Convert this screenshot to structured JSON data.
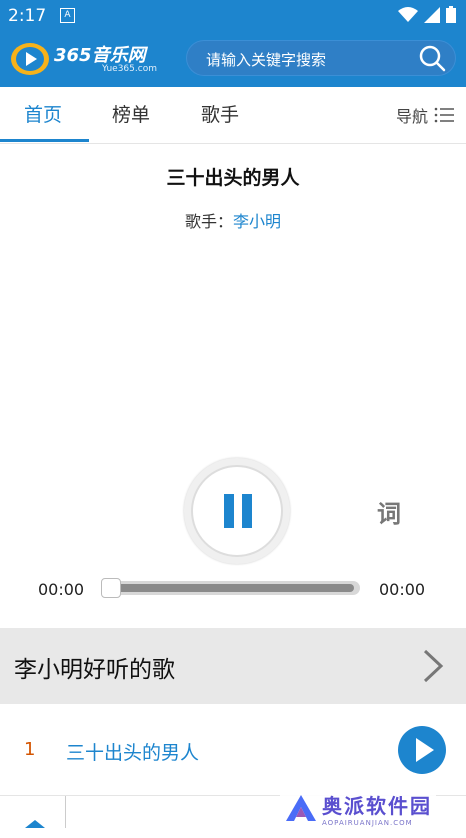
{
  "status": {
    "time": "2:17",
    "notif": "A"
  },
  "header": {
    "logo_text": "365音乐网",
    "logo_sub": "Yue365.com",
    "search_placeholder": "请输入关键字搜索"
  },
  "tabs": [
    {
      "label": "首页"
    },
    {
      "label": "榜单"
    },
    {
      "label": "歌手"
    }
  ],
  "nav_label": "导航",
  "player": {
    "title": "三十出头的男人",
    "artist_prefix": "歌手：",
    "artist": "李小明",
    "lyrics_label": "词",
    "time_current": "00:00",
    "time_total": "00:00",
    "progress": 0
  },
  "section": {
    "title": "李小明好听的歌"
  },
  "songs": [
    {
      "index": "1",
      "title": "三十出头的男人"
    }
  ],
  "watermark": {
    "text": "奥派软件园",
    "sub": "AOPAIRUANJIAN.COM"
  },
  "colors": {
    "accent": "#1d85ce",
    "index": "#d35400"
  }
}
